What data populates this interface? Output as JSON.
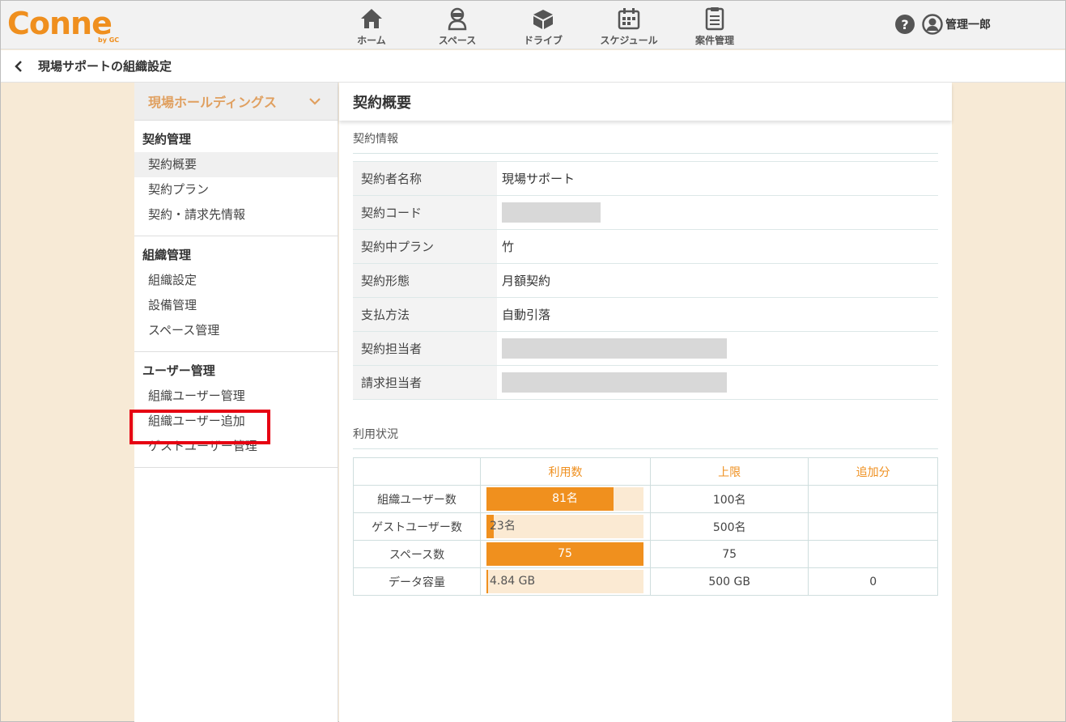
{
  "header": {
    "logo": "Conne",
    "logo_by": "by GC",
    "nav": [
      {
        "label": "ホーム",
        "icon": "home-icon"
      },
      {
        "label": "スペース",
        "icon": "space-icon"
      },
      {
        "label": "ドライブ",
        "icon": "drive-icon"
      },
      {
        "label": "スケジュール",
        "icon": "calendar-icon"
      },
      {
        "label": "案件管理",
        "icon": "clipboard-icon"
      }
    ],
    "help": "?",
    "user_name": "管理一郎"
  },
  "subbar": {
    "title": "現場サポートの組織設定"
  },
  "sidebar": {
    "org_name": "現場ホールディングス",
    "sections": [
      {
        "title": "契約管理",
        "items": [
          "契約概要",
          "契約プラン",
          "契約・請求先情報"
        ]
      },
      {
        "title": "組織管理",
        "items": [
          "組織設定",
          "設備管理",
          "スペース管理"
        ]
      },
      {
        "title": "ユーザー管理",
        "items": [
          "組織ユーザー管理",
          "組織ユーザー追加",
          "ゲストユーザー管理"
        ]
      }
    ]
  },
  "main": {
    "title": "契約概要",
    "contract_section": "契約情報",
    "contract_rows": [
      {
        "key": "契約者名称",
        "value": "現場サポート"
      },
      {
        "key": "契約コード",
        "value": ""
      },
      {
        "key": "契約中プラン",
        "value": "竹"
      },
      {
        "key": "契約形態",
        "value": "月額契約"
      },
      {
        "key": "支払方法",
        "value": "自動引落"
      },
      {
        "key": "契約担当者",
        "value": ""
      },
      {
        "key": "請求担当者",
        "value": ""
      }
    ],
    "usage_section": "利用状況",
    "usage_headers": [
      "",
      "利用数",
      "上限",
      "追加分"
    ],
    "usage_rows": [
      {
        "label": "組織ユーザー数",
        "used": "81名",
        "fill": 0.81,
        "limit": "100名",
        "extra": ""
      },
      {
        "label": "ゲストユーザー数",
        "used": "23名",
        "fill": 0.046,
        "limit": "500名",
        "extra": ""
      },
      {
        "label": "スペース数",
        "used": "75",
        "fill": 1.0,
        "limit": "75",
        "extra": ""
      },
      {
        "label": "データ容量",
        "used": "4.84 GB",
        "fill": 0.0097,
        "limit": "500 GB",
        "extra": "0"
      }
    ]
  },
  "colors": {
    "accent": "#ef8f1e",
    "highlight": "#e60012",
    "page_bg": "#f7ead6"
  }
}
